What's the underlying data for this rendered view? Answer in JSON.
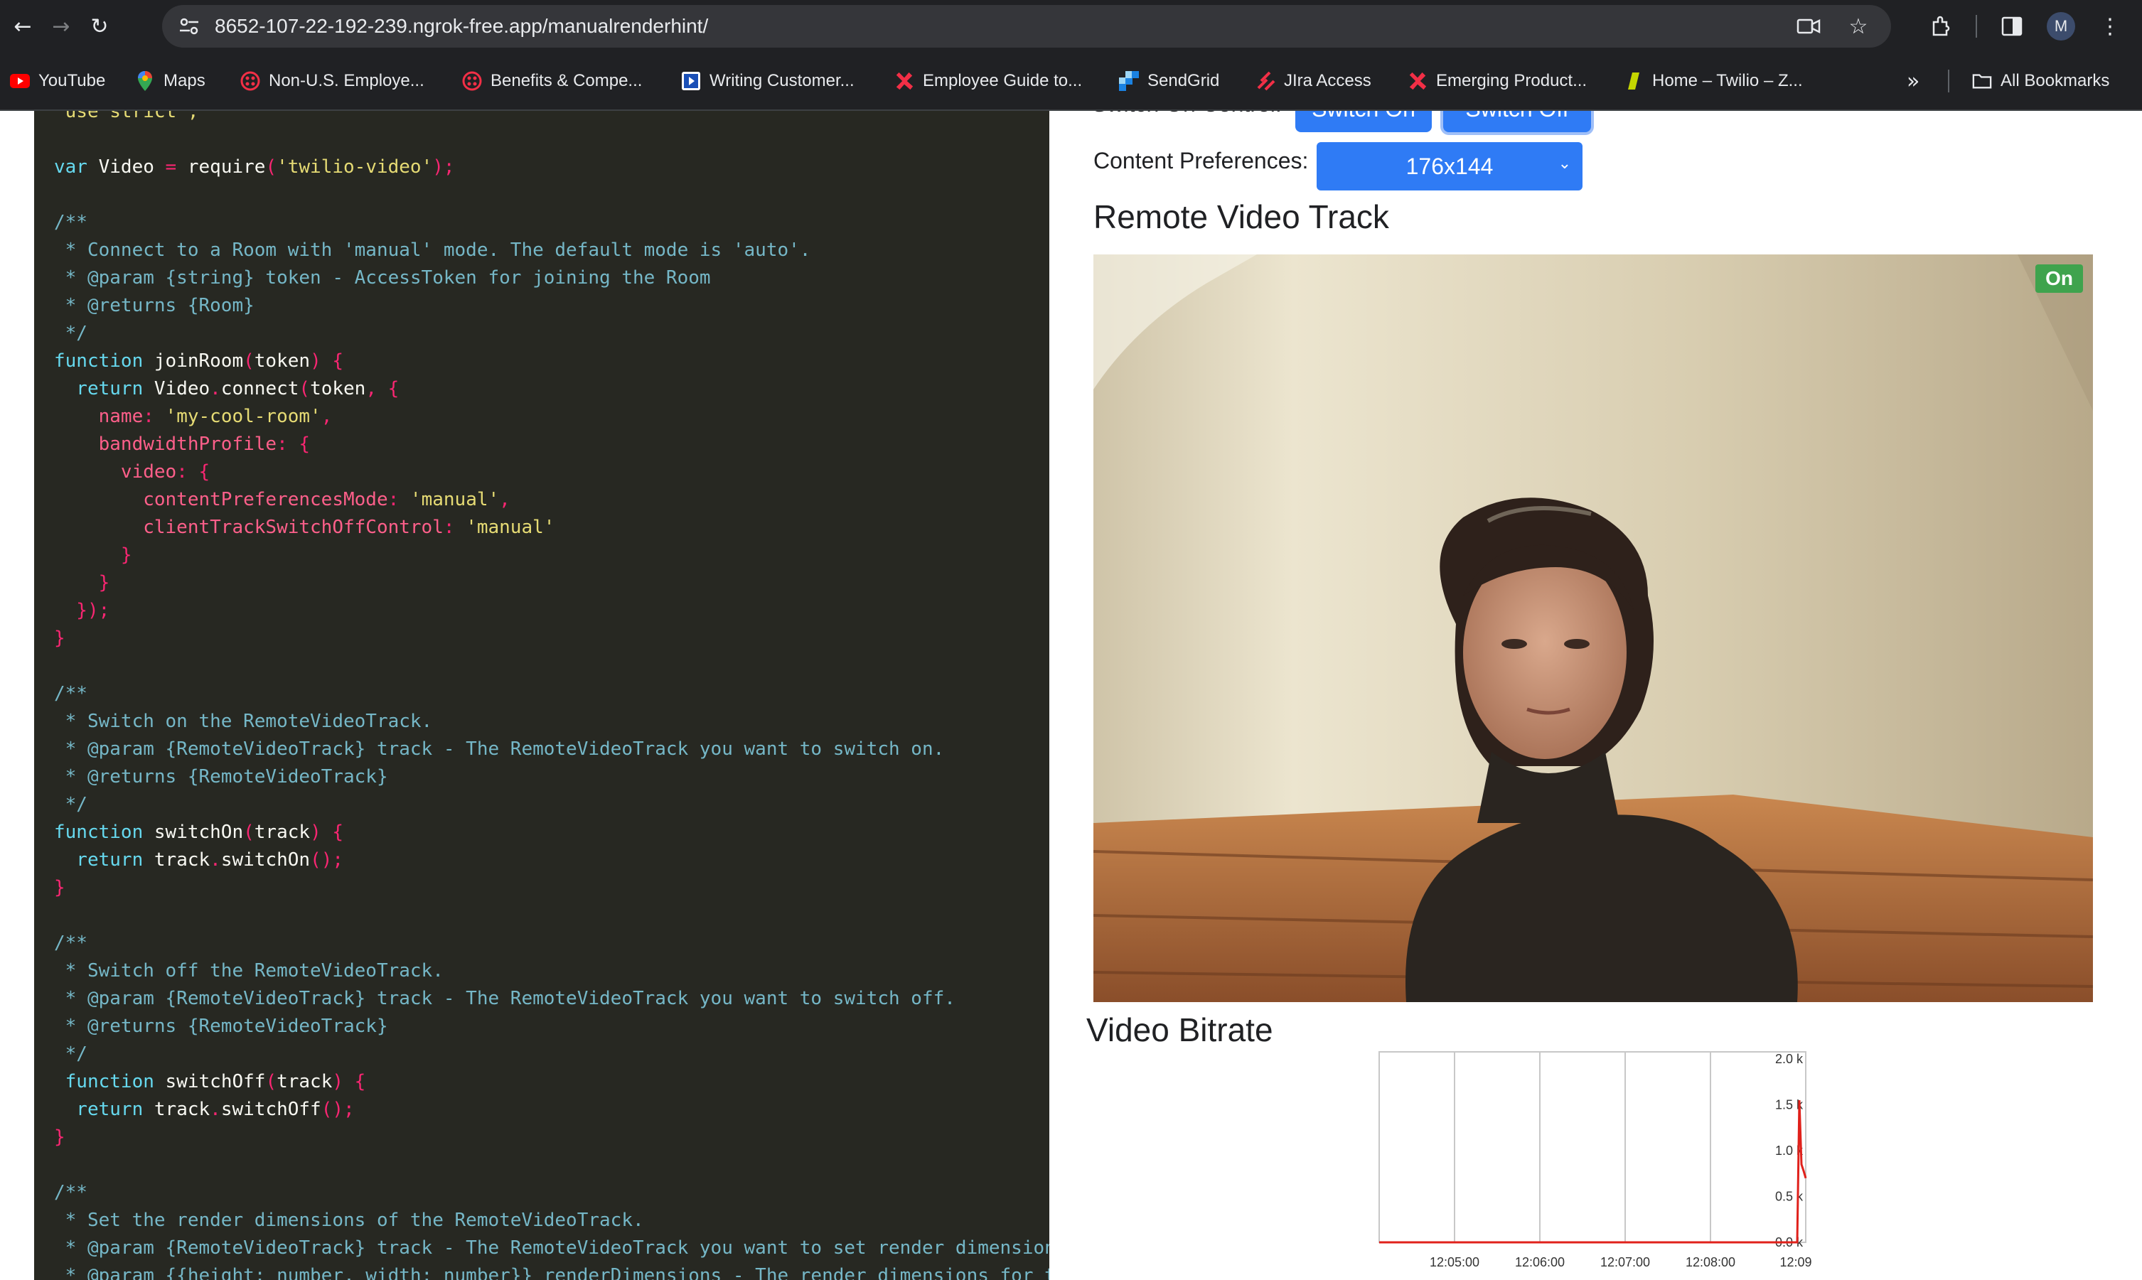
{
  "browser": {
    "url": "8652-107-22-192-239.ngrok-free.app/manualrenderhint/",
    "avatar_letter": "M",
    "all_bookmarks_label": "All Bookmarks",
    "bookmarks": [
      {
        "label": "YouTube",
        "icon": "youtube-icon"
      },
      {
        "label": "Maps",
        "icon": "maps-icon"
      },
      {
        "label": "Non-U.S. Employe...",
        "icon": "target-icon"
      },
      {
        "label": "Benefits & Compe...",
        "icon": "target-icon"
      },
      {
        "label": "Writing Customer...",
        "icon": "play-doc-icon"
      },
      {
        "label": "Employee Guide to...",
        "icon": "twilio-x-icon"
      },
      {
        "label": "SendGrid",
        "icon": "sendgrid-icon"
      },
      {
        "label": "JIra Access",
        "icon": "jira-icon"
      },
      {
        "label": "Emerging Product...",
        "icon": "twilio-x-icon"
      },
      {
        "label": "Home – Twilio – Z...",
        "icon": "zendesk-icon"
      }
    ]
  },
  "code": {
    "lines": [
      [
        {
          "t": "'use strict';",
          "c": "c-str"
        }
      ],
      [],
      [
        {
          "t": "var ",
          "c": "c-kw"
        },
        {
          "t": "Video ",
          "c": "c-plain"
        },
        {
          "t": "= ",
          "c": "c-punct"
        },
        {
          "t": "require",
          "c": "c-plain"
        },
        {
          "t": "(",
          "c": "c-punct"
        },
        {
          "t": "'twilio-video'",
          "c": "c-str"
        },
        {
          "t": ");",
          "c": "c-punct"
        }
      ],
      [],
      [
        {
          "t": "/**",
          "c": "c-comment"
        }
      ],
      [
        {
          "t": " * Connect to a Room with 'manual' mode. The default mode is 'auto'.",
          "c": "c-comment"
        }
      ],
      [
        {
          "t": " * @param {string} token - AccessToken for joining the Room",
          "c": "c-comment"
        }
      ],
      [
        {
          "t": " * @returns {Room}",
          "c": "c-comment"
        }
      ],
      [
        {
          "t": " */",
          "c": "c-comment"
        }
      ],
      [
        {
          "t": "function ",
          "c": "c-kw"
        },
        {
          "t": "joinRoom",
          "c": "c-plain"
        },
        {
          "t": "(",
          "c": "c-punct"
        },
        {
          "t": "token",
          "c": "c-plain"
        },
        {
          "t": ") {",
          "c": "c-punct"
        }
      ],
      [
        {
          "t": "  return ",
          "c": "c-kw"
        },
        {
          "t": "Video",
          "c": "c-plain"
        },
        {
          "t": ".",
          "c": "c-punct"
        },
        {
          "t": "connect",
          "c": "c-plain"
        },
        {
          "t": "(",
          "c": "c-punct"
        },
        {
          "t": "token",
          "c": "c-plain"
        },
        {
          "t": ", {",
          "c": "c-punct"
        }
      ],
      [
        {
          "t": "    name",
          "c": "c-prop"
        },
        {
          "t": ": ",
          "c": "c-punct"
        },
        {
          "t": "'my-cool-room'",
          "c": "c-str"
        },
        {
          "t": ",",
          "c": "c-punct"
        }
      ],
      [
        {
          "t": "    bandwidthProfile",
          "c": "c-prop"
        },
        {
          "t": ": {",
          "c": "c-punct"
        }
      ],
      [
        {
          "t": "      video",
          "c": "c-prop"
        },
        {
          "t": ": {",
          "c": "c-punct"
        }
      ],
      [
        {
          "t": "        contentPreferencesMode",
          "c": "c-prop"
        },
        {
          "t": ": ",
          "c": "c-punct"
        },
        {
          "t": "'manual'",
          "c": "c-str"
        },
        {
          "t": ",",
          "c": "c-punct"
        }
      ],
      [
        {
          "t": "        clientTrackSwitchOffControl",
          "c": "c-prop"
        },
        {
          "t": ": ",
          "c": "c-punct"
        },
        {
          "t": "'manual'",
          "c": "c-str"
        }
      ],
      [
        {
          "t": "      }",
          "c": "c-punct"
        }
      ],
      [
        {
          "t": "    }",
          "c": "c-punct"
        }
      ],
      [
        {
          "t": "  });",
          "c": "c-punct"
        }
      ],
      [
        {
          "t": "}",
          "c": "c-punct"
        }
      ],
      [],
      [
        {
          "t": "/**",
          "c": "c-comment"
        }
      ],
      [
        {
          "t": " * Switch on the RemoteVideoTrack.",
          "c": "c-comment"
        }
      ],
      [
        {
          "t": " * @param {RemoteVideoTrack} track - The RemoteVideoTrack you want to switch on.",
          "c": "c-comment"
        }
      ],
      [
        {
          "t": " * @returns {RemoteVideoTrack}",
          "c": "c-comment"
        }
      ],
      [
        {
          "t": " */",
          "c": "c-comment"
        }
      ],
      [
        {
          "t": "function ",
          "c": "c-kw"
        },
        {
          "t": "switchOn",
          "c": "c-plain"
        },
        {
          "t": "(",
          "c": "c-punct"
        },
        {
          "t": "track",
          "c": "c-plain"
        },
        {
          "t": ") {",
          "c": "c-punct"
        }
      ],
      [
        {
          "t": "  return ",
          "c": "c-kw"
        },
        {
          "t": "track",
          "c": "c-plain"
        },
        {
          "t": ".",
          "c": "c-punct"
        },
        {
          "t": "switchOn",
          "c": "c-plain"
        },
        {
          "t": "();",
          "c": "c-punct"
        }
      ],
      [
        {
          "t": "}",
          "c": "c-punct"
        }
      ],
      [],
      [
        {
          "t": "/**",
          "c": "c-comment"
        }
      ],
      [
        {
          "t": " * Switch off the RemoteVideoTrack.",
          "c": "c-comment"
        }
      ],
      [
        {
          "t": " * @param {RemoteVideoTrack} track - The RemoteVideoTrack you want to switch off.",
          "c": "c-comment"
        }
      ],
      [
        {
          "t": " * @returns {RemoteVideoTrack}",
          "c": "c-comment"
        }
      ],
      [
        {
          "t": " */",
          "c": "c-comment"
        }
      ],
      [
        {
          "t": " function ",
          "c": "c-kw"
        },
        {
          "t": "switchOff",
          "c": "c-plain"
        },
        {
          "t": "(",
          "c": "c-punct"
        },
        {
          "t": "track",
          "c": "c-plain"
        },
        {
          "t": ") {",
          "c": "c-punct"
        }
      ],
      [
        {
          "t": "  return ",
          "c": "c-kw"
        },
        {
          "t": "track",
          "c": "c-plain"
        },
        {
          "t": ".",
          "c": "c-punct"
        },
        {
          "t": "switchOff",
          "c": "c-plain"
        },
        {
          "t": "();",
          "c": "c-punct"
        }
      ],
      [
        {
          "t": "}",
          "c": "c-punct"
        }
      ],
      [],
      [
        {
          "t": "/**",
          "c": "c-comment"
        }
      ],
      [
        {
          "t": " * Set the render dimensions of the RemoteVideoTrack.",
          "c": "c-comment"
        }
      ],
      [
        {
          "t": " * @param {RemoteVideoTrack} track - The RemoteVideoTrack you want to set render dimensions",
          "c": "c-comment"
        }
      ],
      [
        {
          "t": " * @param {{height: number, width: number}} renderDimensions - The render dimensions for t",
          "c": "c-comment"
        }
      ]
    ]
  },
  "controls": {
    "switch_label": "Switch On Control:",
    "switch_on_label": "Switch On",
    "switch_off_label": "Switch Off",
    "content_pref_label": "Content Preferences:",
    "content_pref_value": "176x144"
  },
  "video": {
    "title": "Remote Video Track",
    "status_badge": "On"
  },
  "bitrate": {
    "title": "Video Bitrate"
  },
  "chart_data": {
    "type": "line",
    "title": "",
    "x": [
      "12:05:00",
      "12:06:00",
      "12:07:00",
      "12:08:00",
      "12:09"
    ],
    "y_ticks": [
      "0.0 k",
      "0.5 k",
      "1.0 k",
      "1.5 k",
      "2.0 k"
    ],
    "ylim": [
      0,
      2000
    ],
    "series": [
      {
        "values": [
          0,
          0,
          0,
          0,
          0,
          0,
          0,
          0,
          0,
          0,
          0,
          0,
          1550,
          850,
          780,
          700
        ],
        "color": "#e0211b"
      }
    ],
    "grid": true
  }
}
